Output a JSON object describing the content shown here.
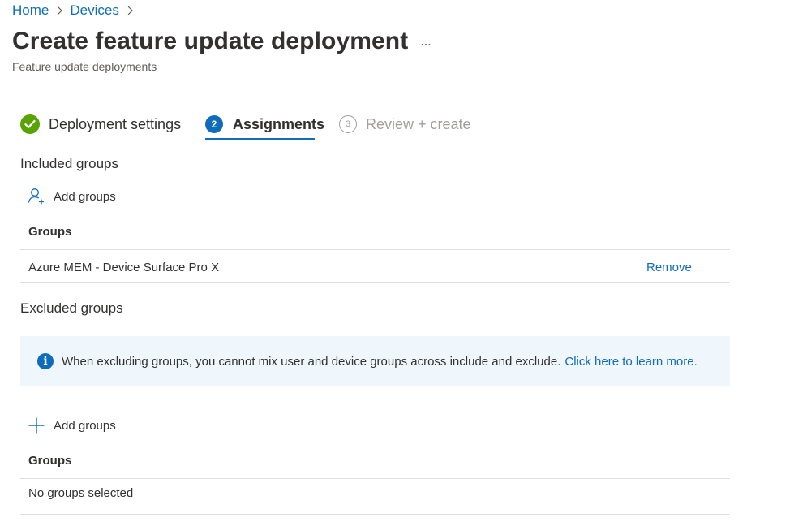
{
  "breadcrumb": {
    "items": [
      "Home",
      "Devices"
    ],
    "separator_icon": "chevron-right-icon"
  },
  "header": {
    "title": "Create feature update deployment",
    "more_label": "...",
    "subtitle": "Feature update deployments"
  },
  "wizard": {
    "steps": [
      {
        "number": "1",
        "label": "Deployment settings",
        "state": "completed"
      },
      {
        "number": "2",
        "label": "Assignments",
        "state": "active"
      },
      {
        "number": "3",
        "label": "Review + create",
        "state": "disabled"
      }
    ]
  },
  "included": {
    "title": "Included groups",
    "add_label": "Add groups",
    "add_icon": "add-user-icon",
    "column_header": "Groups",
    "rows": [
      {
        "name": "Azure MEM - Device Surface Pro X",
        "action": "Remove"
      }
    ]
  },
  "excluded": {
    "title": "Excluded groups",
    "info_icon": "info-icon",
    "info_text": "When excluding groups, you cannot mix user and device groups across include and exclude.",
    "info_link": "Click here to learn more.",
    "add_label": "Add groups",
    "add_icon": "plus-icon",
    "column_header": "Groups",
    "empty_text": "No groups selected"
  },
  "colors": {
    "accent": "#0f6cbd",
    "success": "#57a300",
    "info_background": "#eff6fc",
    "disabled": "#a19f9d"
  }
}
